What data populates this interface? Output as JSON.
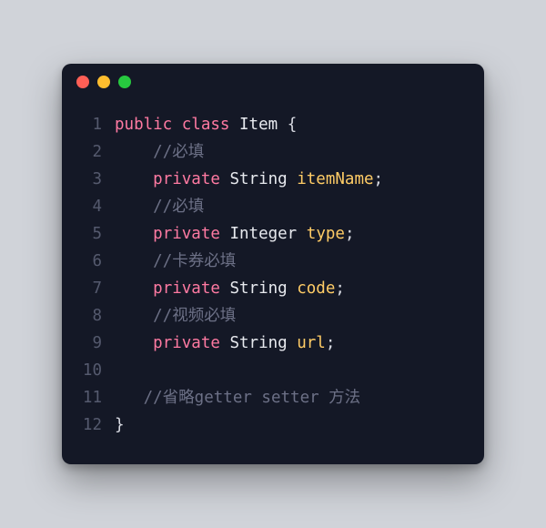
{
  "colors": {
    "window_bg": "#141826",
    "page_bg": "#d0d3d9",
    "traffic_red": "#ff5f56",
    "traffic_yellow": "#ffbd2e",
    "traffic_green": "#27c93f",
    "keyword": "#ff7aa2",
    "type": "#e7e9ee",
    "identifier": "#ffcc66",
    "comment": "#6c7086",
    "punct": "#d9dbe3",
    "gutter": "#555a6e"
  },
  "code": {
    "language": "java",
    "lines": [
      {
        "n": "1",
        "indent": "",
        "tokens": [
          [
            "kw",
            "public"
          ],
          [
            "plain",
            " "
          ],
          [
            "kw",
            "class"
          ],
          [
            "plain",
            " "
          ],
          [
            "type",
            "Item"
          ],
          [
            "plain",
            " "
          ],
          [
            "punct",
            "{"
          ]
        ]
      },
      {
        "n": "2",
        "indent": "    ",
        "tokens": [
          [
            "comment",
            "//必填"
          ]
        ]
      },
      {
        "n": "3",
        "indent": "    ",
        "tokens": [
          [
            "kw",
            "private"
          ],
          [
            "plain",
            " "
          ],
          [
            "type",
            "String"
          ],
          [
            "plain",
            " "
          ],
          [
            "ident",
            "itemName"
          ],
          [
            "punct",
            ";"
          ]
        ]
      },
      {
        "n": "4",
        "indent": "    ",
        "tokens": [
          [
            "comment",
            "//必填"
          ]
        ]
      },
      {
        "n": "5",
        "indent": "    ",
        "tokens": [
          [
            "kw",
            "private"
          ],
          [
            "plain",
            " "
          ],
          [
            "type",
            "Integer"
          ],
          [
            "plain",
            " "
          ],
          [
            "ident",
            "type"
          ],
          [
            "punct",
            ";"
          ]
        ]
      },
      {
        "n": "6",
        "indent": "    ",
        "tokens": [
          [
            "comment",
            "//卡券必填"
          ]
        ]
      },
      {
        "n": "7",
        "indent": "    ",
        "tokens": [
          [
            "kw",
            "private"
          ],
          [
            "plain",
            " "
          ],
          [
            "type",
            "String"
          ],
          [
            "plain",
            " "
          ],
          [
            "ident",
            "code"
          ],
          [
            "punct",
            ";"
          ]
        ]
      },
      {
        "n": "8",
        "indent": "    ",
        "tokens": [
          [
            "comment",
            "//视频必填"
          ]
        ]
      },
      {
        "n": "9",
        "indent": "    ",
        "tokens": [
          [
            "kw",
            "private"
          ],
          [
            "plain",
            " "
          ],
          [
            "type",
            "String"
          ],
          [
            "plain",
            " "
          ],
          [
            "ident",
            "url"
          ],
          [
            "punct",
            ";"
          ]
        ]
      },
      {
        "n": "10",
        "indent": "",
        "tokens": []
      },
      {
        "n": "11",
        "indent": "   ",
        "tokens": [
          [
            "comment",
            "//省略getter setter 方法"
          ]
        ]
      },
      {
        "n": "12",
        "indent": "",
        "tokens": [
          [
            "punct",
            "}"
          ]
        ]
      }
    ]
  }
}
